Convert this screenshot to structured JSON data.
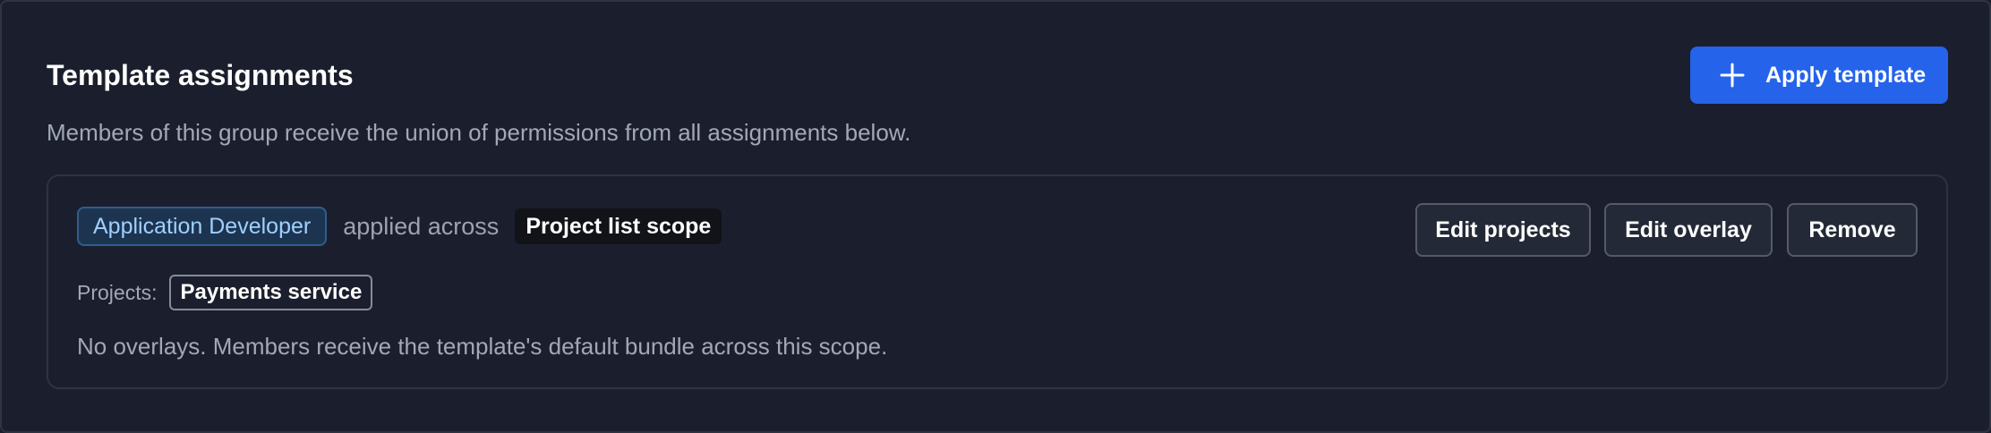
{
  "section": {
    "title": "Template assignments",
    "description": "Members of this group receive the union of permissions from all assignments below.",
    "apply_button_label": "Apply template",
    "apply_button_icon": "plus-icon"
  },
  "assignment": {
    "template_name": "Application Developer",
    "applied_across_text": "applied across",
    "scope": "Project list scope",
    "projects_label": "Projects:",
    "projects": [
      "Payments service"
    ],
    "overlay_note": "No overlays. Members receive the template's default bundle across this scope.",
    "actions": {
      "edit_projects": "Edit projects",
      "edit_overlay": "Edit overlay",
      "remove": "Remove"
    }
  },
  "colors": {
    "background": "#1b1f2d",
    "primary": "#2563eb",
    "badge_text": "#9fd0ff",
    "muted_text": "#a3a8b5"
  }
}
